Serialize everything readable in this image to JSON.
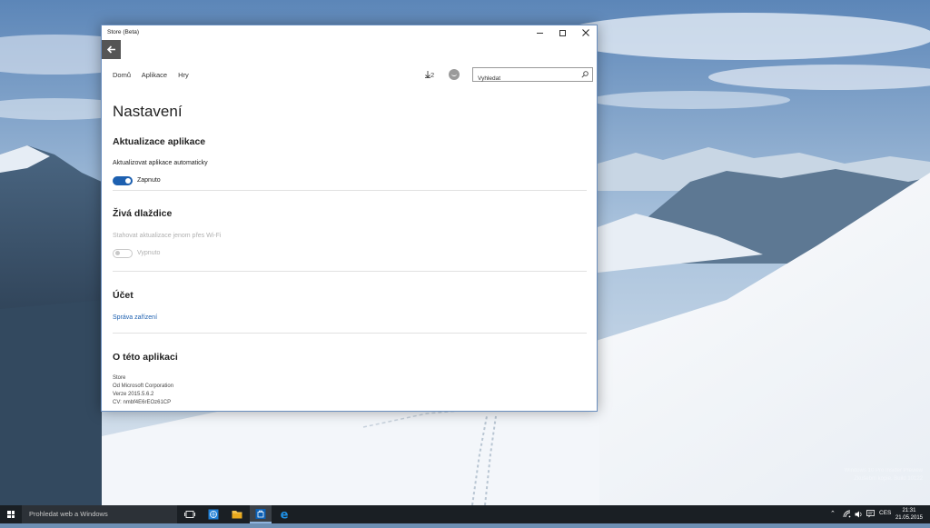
{
  "window": {
    "title": "Store (Beta)",
    "nav": [
      "Domů",
      "Aplikace",
      "Hry"
    ],
    "downloads": "2",
    "search_placeholder": "Vyhledat",
    "page_title": "Nastavení",
    "sections": {
      "updates": {
        "heading": "Aktualizace aplikace",
        "label": "Aktualizovat aplikace automaticky",
        "toggle_state": "Zapnuto"
      },
      "live_tiles": {
        "heading": "Živá dlaždice",
        "label": "Stahovat aktualizace jenom přes Wi-Fi",
        "toggle_state": "Vypnuto"
      },
      "account": {
        "heading": "Účet",
        "link": "Správa zařízení"
      },
      "about": {
        "heading": "O této aplikaci",
        "lines": [
          "Store",
          "Od Microsoft Corporation",
          "Verze 2015.5.6.2",
          "CV: nmbf4E6rEOz61CP"
        ]
      }
    }
  },
  "taskbar": {
    "search_text": "Prohledat web a Windows",
    "language": "CES",
    "time": "21:31",
    "date": "21.05.2015"
  },
  "watermark": {
    "line1": "Windows 10 Pro Insider Preview",
    "line2": "Zkušební kopie. Build 10122"
  },
  "colors": {
    "accent": "#1d60b0",
    "taskbar": "#1a1f24",
    "store_tile": "#0a5fb4",
    "edge_icon": "#1e90e6"
  },
  "icons": [
    "back-arrow-icon",
    "download-icon",
    "account-icon",
    "search-icon",
    "windows-logo-icon",
    "task-view-icon",
    "store-icon",
    "file-explorer-icon",
    "edge-icon",
    "network-icon",
    "volume-icon",
    "action-center-icon"
  ]
}
